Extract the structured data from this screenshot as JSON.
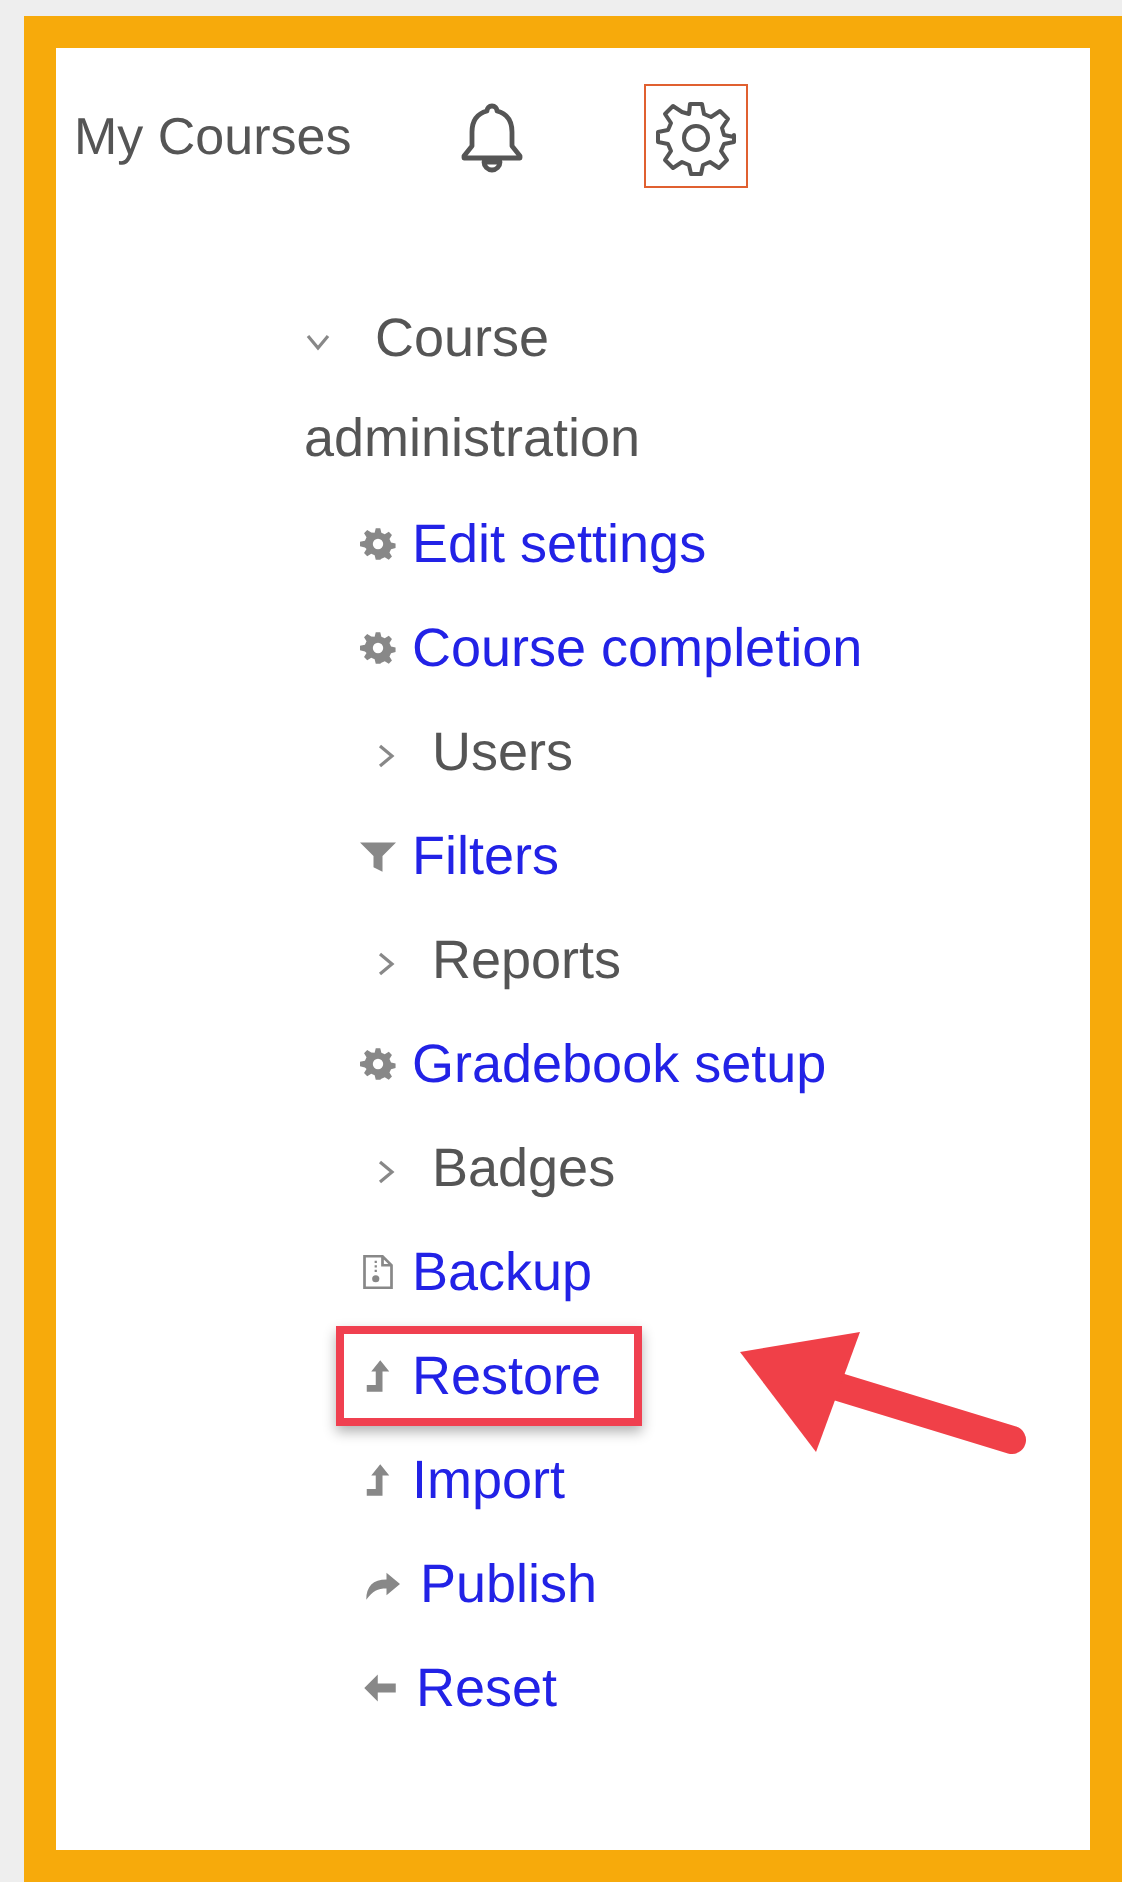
{
  "header": {
    "title": "My Courses"
  },
  "tree": {
    "label": "Course administration",
    "expanded": true,
    "children": [
      {
        "kind": "link",
        "label": "Edit settings",
        "highlighted": false
      },
      {
        "kind": "link",
        "label": "Course completion",
        "highlighted": false
      },
      {
        "kind": "branch",
        "label": "Users",
        "expanded": false
      },
      {
        "kind": "link",
        "label": "Filters",
        "highlighted": false
      },
      {
        "kind": "branch",
        "label": "Reports",
        "expanded": false
      },
      {
        "kind": "link",
        "label": "Gradebook setup",
        "highlighted": false
      },
      {
        "kind": "branch",
        "label": "Badges",
        "expanded": false
      },
      {
        "kind": "link",
        "label": "Backup",
        "highlighted": false
      },
      {
        "kind": "link",
        "label": "Restore",
        "highlighted": true
      },
      {
        "kind": "link",
        "label": "Import",
        "highlighted": false
      },
      {
        "kind": "link",
        "label": "Publish",
        "highlighted": false
      },
      {
        "kind": "link",
        "label": "Reset",
        "highlighted": false
      }
    ]
  }
}
